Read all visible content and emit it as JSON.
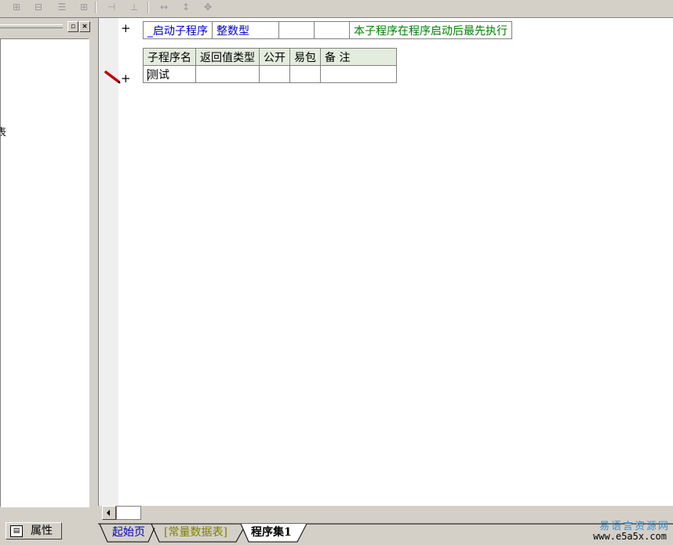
{
  "header_table": {
    "name": "_启动子程序",
    "type": "整数型",
    "col3": "",
    "col4": "",
    "note": "本子程序在程序启动后最先执行"
  },
  "sub_table": {
    "headers": [
      "子程序名",
      "返回值类型",
      "公开",
      "易包",
      "备 注"
    ],
    "row": {
      "name": "测试",
      "ret": "",
      "public": "",
      "pkg": "",
      "note": ""
    }
  },
  "left_panel": {
    "partial_text": "表"
  },
  "bottom_left": {
    "prop_label": "属性"
  },
  "tabs": {
    "start_page": "起始页",
    "const_table": "[常量数据表]",
    "program_set": "程序集1"
  },
  "watermark": {
    "cn": "易语言资源网",
    "url": "www.e5a5x.com"
  },
  "gutter": {
    "plus": "+"
  },
  "colors": {
    "green_note": "#008000",
    "blue_text": "#0000c0",
    "header_bg": "#e4ecde"
  }
}
